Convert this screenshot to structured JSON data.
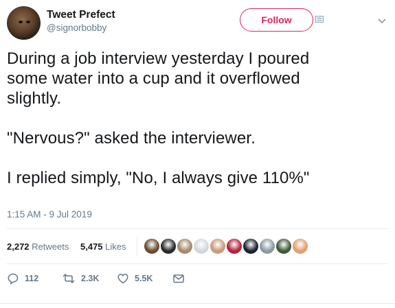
{
  "author": {
    "name": "Tweet Prefect",
    "handle": "@signorbobby",
    "follow_label": "Follow"
  },
  "tweet": {
    "text": "During a job interview yesterday I poured\nsome water into a cup and it overflowed\nslightly.\n\n\"Nervous?\" asked the interviewer.\n\nI replied simply, \"No, I always give 110%\"",
    "timestamp": "1:15 AM - 9 Jul 2019"
  },
  "stats": {
    "retweets_count": "2,272",
    "retweets_label": "Retweets",
    "likes_count": "5,475",
    "likes_label": "Likes"
  },
  "likers": [
    {
      "icon": "liker-avatar-1",
      "color": "#6b4b2e"
    },
    {
      "icon": "liker-avatar-2",
      "color": "#2b2b2b"
    },
    {
      "icon": "liker-avatar-3",
      "color": "#a38a6c"
    },
    {
      "icon": "liker-avatar-4",
      "color": "#d4d7da"
    },
    {
      "icon": "liker-avatar-5",
      "color": "#c89b7b"
    },
    {
      "icon": "liker-avatar-6",
      "color": "#b0243a"
    },
    {
      "icon": "liker-avatar-7",
      "color": "#1d2230"
    },
    {
      "icon": "liker-avatar-8",
      "color": "#8d9aa3"
    },
    {
      "icon": "liker-avatar-9",
      "color": "#3f5a3a"
    },
    {
      "icon": "liker-avatar-10",
      "color": "#e0a070"
    }
  ],
  "actions": {
    "replies": "112",
    "retweets": "2.3K",
    "likes": "5.5K"
  },
  "colors": {
    "follow_accent": "#e0245e",
    "secondary_text": "#657786",
    "primary_text": "#14171a",
    "divider": "#e6ecf0"
  }
}
